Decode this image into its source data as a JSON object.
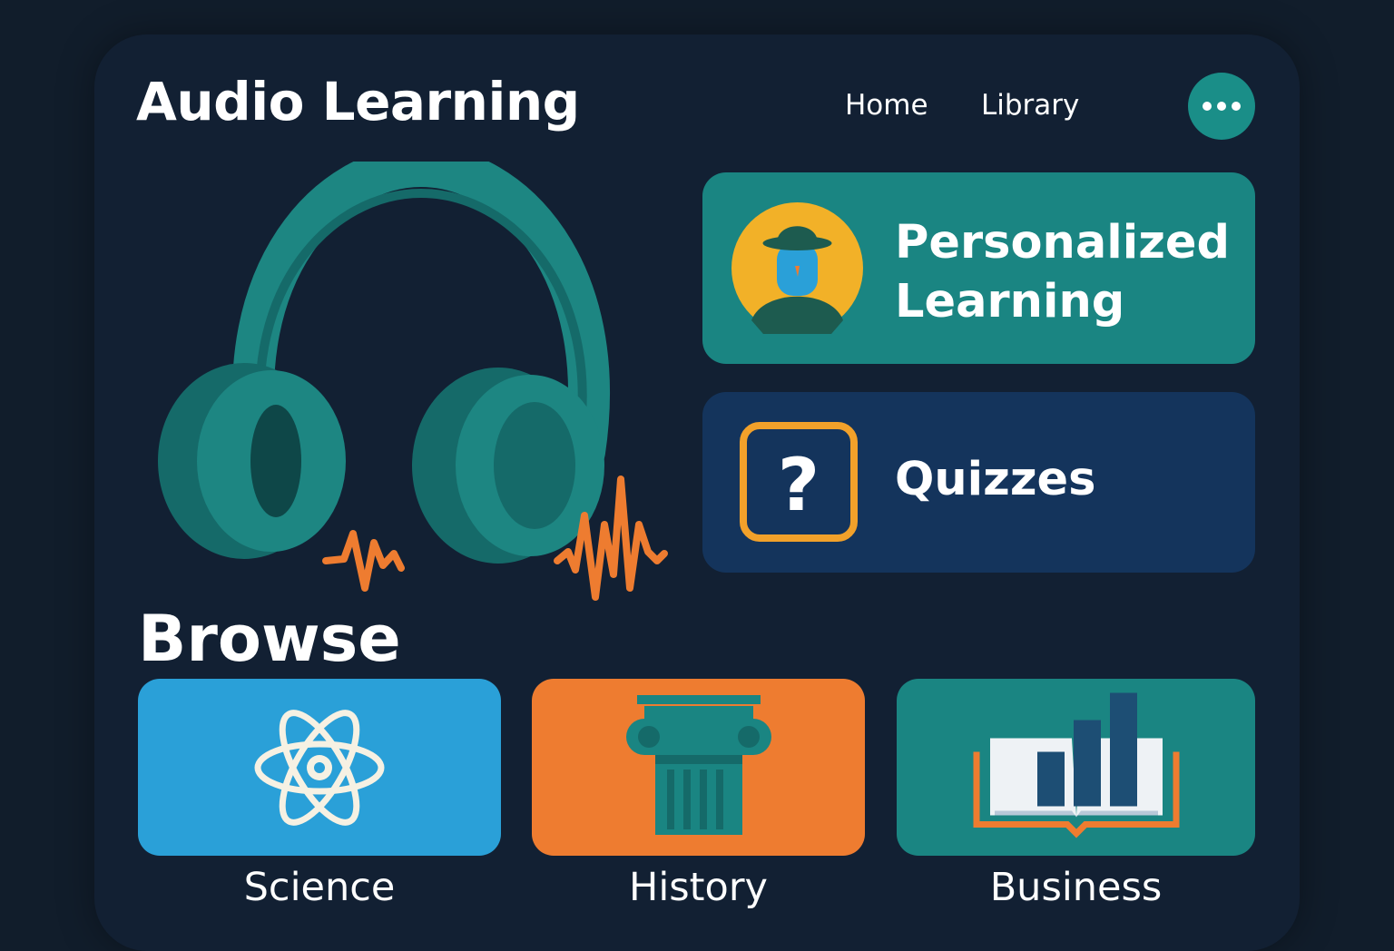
{
  "header": {
    "title": "Audio Learning",
    "nav": {
      "home": "Home",
      "library": "Library"
    },
    "more_icon": "more-horizontal-icon"
  },
  "features": {
    "personalized": {
      "label_line1": "Personalized",
      "label_line2": "Learning",
      "icon": "person-avatar-icon"
    },
    "quizzes": {
      "label": "Quizzes",
      "icon": "question-mark-icon"
    }
  },
  "browse": {
    "title": "Browse",
    "categories": [
      {
        "label": "Science",
        "icon": "atom-icon",
        "color": "#2aa0d8"
      },
      {
        "label": "History",
        "icon": "column-icon",
        "color": "#ee7c30"
      },
      {
        "label": "Business",
        "icon": "book-chart-icon",
        "color": "#1a8582"
      }
    ]
  },
  "colors": {
    "background": "#111d2b",
    "panel": "#122033",
    "teal": "#1a8582",
    "navy": "#14345c",
    "orange": "#ee7c30",
    "blue": "#2aa0d8"
  }
}
